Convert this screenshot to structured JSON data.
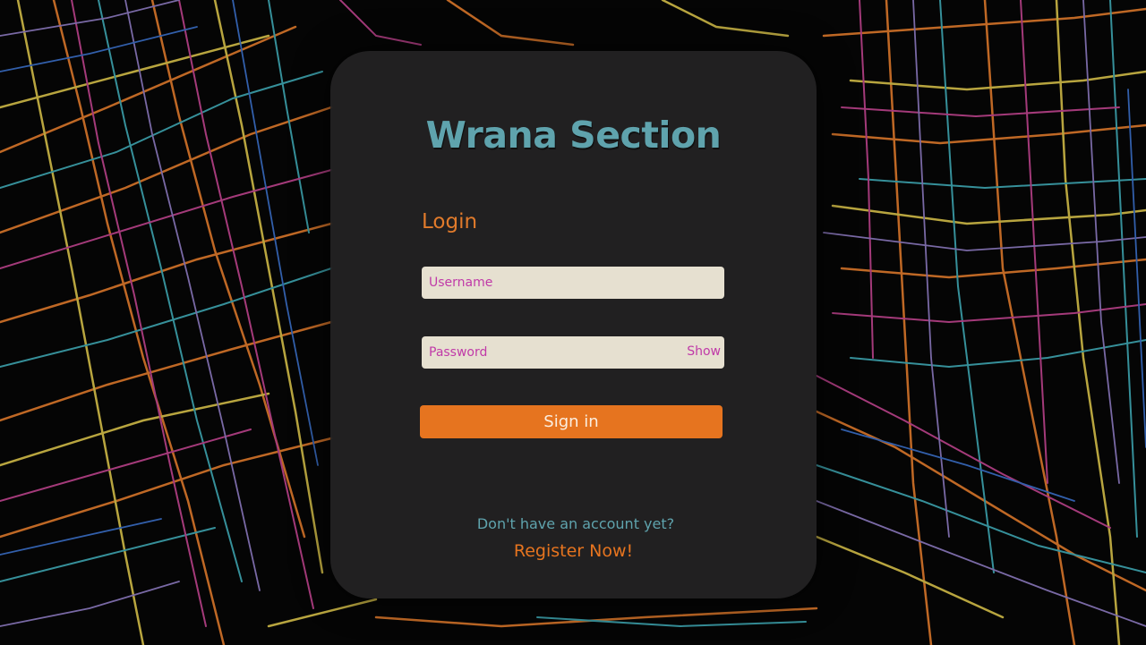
{
  "app": {
    "title": "Wrana Section"
  },
  "login": {
    "heading": "Login",
    "username_placeholder": "Username",
    "password_placeholder": "Password",
    "show_label": "Show",
    "signin_label": "Sign in"
  },
  "footer": {
    "no_account_text": "Don't have an account yet?",
    "register_label": "Register Now!"
  },
  "colors": {
    "title": "#5fa3ad",
    "accent_orange": "#e6741f",
    "input_bg": "#e6e0d0",
    "input_text": "#c03aa8",
    "card_bg": "#242224"
  }
}
